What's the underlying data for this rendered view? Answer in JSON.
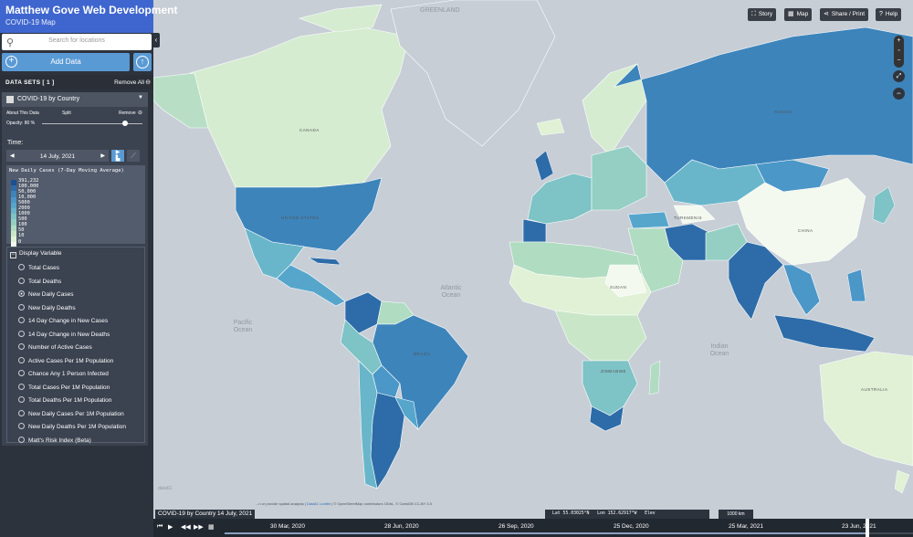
{
  "brand": {
    "title": "Matthew Gove Web Development",
    "subtitle": "COVID-19 Map"
  },
  "search": {
    "placeholder": "Search for locations"
  },
  "add_data": {
    "label": "Add Data"
  },
  "datasets": {
    "header": "DATA SETS  [ 1 ]",
    "remove_all": "Remove All"
  },
  "dataset": {
    "name": "COVID-19 by Country",
    "about": "About This Data",
    "split": "Split",
    "remove": "Remove",
    "opacity": "Opacity: 80 %",
    "time_label": "Time:",
    "date": "14 July, 2021"
  },
  "legend": {
    "title": "New Daily Cases (7-Day Moving Average)",
    "labels": [
      "391,232",
      "100,000",
      "50,000",
      "10,000",
      "5000",
      "2000",
      "1000",
      "500",
      "100",
      "50",
      "10",
      "0"
    ],
    "colors": [
      "#1d4f91",
      "#2d6ca8",
      "#3d84bb",
      "#4b97c8",
      "#56a6cc",
      "#69b6ca",
      "#7ec3c6",
      "#95cfc3",
      "#b0dcc2",
      "#c9e7c8",
      "#e0f1d6",
      "#f3f9ee"
    ]
  },
  "display_variable": {
    "header": "Display Variable",
    "options": [
      "Total Cases",
      "Total Deaths",
      "New Daily Cases",
      "New Daily Deaths",
      "14 Day Change in New Cases",
      "14 Day Change in New Deaths",
      "Number of Active Cases",
      "Active Cases Per 1M Population",
      "Chance Any 1 Person Infected",
      "Total Cases Per 1M Population",
      "Total Deaths Per 1M Population",
      "New Daily Cases Per 1M Population",
      "New Daily Deaths Per 1M Population",
      "Matt's Risk Index (Beta)"
    ],
    "selected": "New Daily Cases"
  },
  "map_buttons": {
    "story": "Story",
    "map": "Map",
    "share": "Share / Print",
    "help": "Help"
  },
  "map_labels": {
    "greenland": "GREENLAND",
    "atlantic": "Atlantic\nOcean",
    "pacific": "Pacific\nOcean",
    "indian": "Indian\nOcean",
    "sudan": "SUDAN",
    "zimbabwe": "ZIMBABWE",
    "turkmenistan": "TURKMENIS",
    "united_states": "UNITED STATES",
    "russia": "RUSSIA",
    "canada": "CANADA",
    "brazil": "BRAZIL",
    "china": "CHINA",
    "australia": "AUSTRALIA"
  },
  "credit": {
    "text": "...n or provide spatial analysis |",
    "link1": "Data61",
    "link2": "Leaflet",
    "rest": "| © OpenStreetMap contributors ODbL, © CartoDB CC-BY 3.0"
  },
  "coords": {
    "lat": "Lat  55.03025°N",
    "lon": "Lon  152.62917°W",
    "elev": "Elev"
  },
  "scale": "1000 km",
  "caption": "COVID-19 by Country 14 July, 2021",
  "timeline": {
    "ticks": [
      "30 Mar, 2020",
      "28 Jun, 2020",
      "26 Sep, 2020",
      "25 Dec, 2020",
      "25 Mar, 2021",
      "23 Jun, 2021"
    ]
  },
  "logo": "data61"
}
